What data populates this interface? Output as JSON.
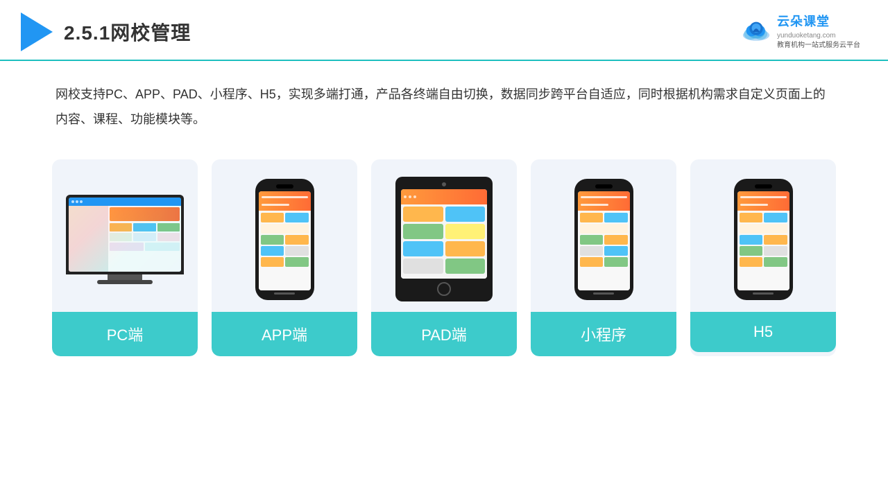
{
  "header": {
    "title": "2.5.1网校管理",
    "brand": {
      "name": "云朵课堂",
      "url": "yunduoketang.com",
      "slogan": "教育机构一站\n式服务云平台"
    }
  },
  "description": {
    "text": "网校支持PC、APP、PAD、小程序、H5，实现多端打通，产品各终端自由切换，数据同步跨平台自适应，同时根据机构需求自定义页面上的内容、课程、功能模块等。"
  },
  "cards": [
    {
      "id": "pc",
      "label": "PC端"
    },
    {
      "id": "app",
      "label": "APP端"
    },
    {
      "id": "pad",
      "label": "PAD端"
    },
    {
      "id": "miniprogram",
      "label": "小程序"
    },
    {
      "id": "h5",
      "label": "H5"
    }
  ],
  "colors": {
    "accent": "#3DCBCB",
    "headerBorder": "#1DBFBF",
    "cardBg": "#f0f4fa",
    "logoBlue": "#2196f3"
  }
}
